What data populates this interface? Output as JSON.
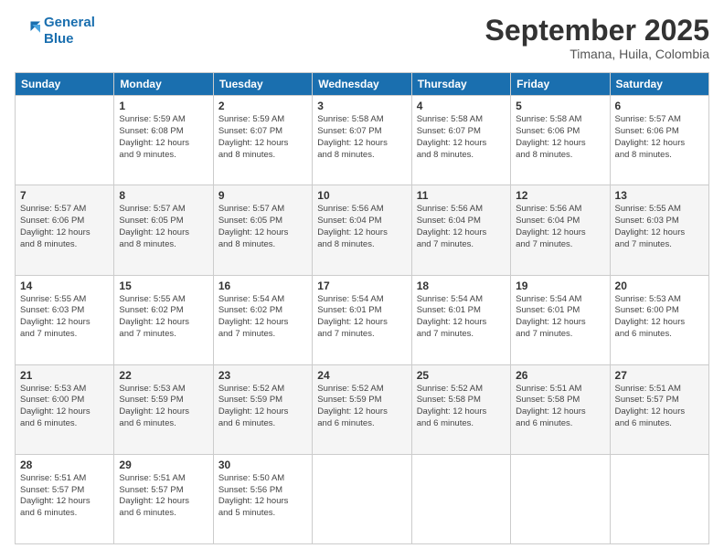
{
  "logo": {
    "line1": "General",
    "line2": "Blue"
  },
  "title": "September 2025",
  "subtitle": "Timana, Huila, Colombia",
  "days_of_week": [
    "Sunday",
    "Monday",
    "Tuesday",
    "Wednesday",
    "Thursday",
    "Friday",
    "Saturday"
  ],
  "weeks": [
    [
      {
        "day": "",
        "info": ""
      },
      {
        "day": "1",
        "info": "Sunrise: 5:59 AM\nSunset: 6:08 PM\nDaylight: 12 hours\nand 9 minutes."
      },
      {
        "day": "2",
        "info": "Sunrise: 5:59 AM\nSunset: 6:07 PM\nDaylight: 12 hours\nand 8 minutes."
      },
      {
        "day": "3",
        "info": "Sunrise: 5:58 AM\nSunset: 6:07 PM\nDaylight: 12 hours\nand 8 minutes."
      },
      {
        "day": "4",
        "info": "Sunrise: 5:58 AM\nSunset: 6:07 PM\nDaylight: 12 hours\nand 8 minutes."
      },
      {
        "day": "5",
        "info": "Sunrise: 5:58 AM\nSunset: 6:06 PM\nDaylight: 12 hours\nand 8 minutes."
      },
      {
        "day": "6",
        "info": "Sunrise: 5:57 AM\nSunset: 6:06 PM\nDaylight: 12 hours\nand 8 minutes."
      }
    ],
    [
      {
        "day": "7",
        "info": "Sunrise: 5:57 AM\nSunset: 6:06 PM\nDaylight: 12 hours\nand 8 minutes."
      },
      {
        "day": "8",
        "info": "Sunrise: 5:57 AM\nSunset: 6:05 PM\nDaylight: 12 hours\nand 8 minutes."
      },
      {
        "day": "9",
        "info": "Sunrise: 5:57 AM\nSunset: 6:05 PM\nDaylight: 12 hours\nand 8 minutes."
      },
      {
        "day": "10",
        "info": "Sunrise: 5:56 AM\nSunset: 6:04 PM\nDaylight: 12 hours\nand 8 minutes."
      },
      {
        "day": "11",
        "info": "Sunrise: 5:56 AM\nSunset: 6:04 PM\nDaylight: 12 hours\nand 7 minutes."
      },
      {
        "day": "12",
        "info": "Sunrise: 5:56 AM\nSunset: 6:04 PM\nDaylight: 12 hours\nand 7 minutes."
      },
      {
        "day": "13",
        "info": "Sunrise: 5:55 AM\nSunset: 6:03 PM\nDaylight: 12 hours\nand 7 minutes."
      }
    ],
    [
      {
        "day": "14",
        "info": "Sunrise: 5:55 AM\nSunset: 6:03 PM\nDaylight: 12 hours\nand 7 minutes."
      },
      {
        "day": "15",
        "info": "Sunrise: 5:55 AM\nSunset: 6:02 PM\nDaylight: 12 hours\nand 7 minutes."
      },
      {
        "day": "16",
        "info": "Sunrise: 5:54 AM\nSunset: 6:02 PM\nDaylight: 12 hours\nand 7 minutes."
      },
      {
        "day": "17",
        "info": "Sunrise: 5:54 AM\nSunset: 6:01 PM\nDaylight: 12 hours\nand 7 minutes."
      },
      {
        "day": "18",
        "info": "Sunrise: 5:54 AM\nSunset: 6:01 PM\nDaylight: 12 hours\nand 7 minutes."
      },
      {
        "day": "19",
        "info": "Sunrise: 5:54 AM\nSunset: 6:01 PM\nDaylight: 12 hours\nand 7 minutes."
      },
      {
        "day": "20",
        "info": "Sunrise: 5:53 AM\nSunset: 6:00 PM\nDaylight: 12 hours\nand 6 minutes."
      }
    ],
    [
      {
        "day": "21",
        "info": "Sunrise: 5:53 AM\nSunset: 6:00 PM\nDaylight: 12 hours\nand 6 minutes."
      },
      {
        "day": "22",
        "info": "Sunrise: 5:53 AM\nSunset: 5:59 PM\nDaylight: 12 hours\nand 6 minutes."
      },
      {
        "day": "23",
        "info": "Sunrise: 5:52 AM\nSunset: 5:59 PM\nDaylight: 12 hours\nand 6 minutes."
      },
      {
        "day": "24",
        "info": "Sunrise: 5:52 AM\nSunset: 5:59 PM\nDaylight: 12 hours\nand 6 minutes."
      },
      {
        "day": "25",
        "info": "Sunrise: 5:52 AM\nSunset: 5:58 PM\nDaylight: 12 hours\nand 6 minutes."
      },
      {
        "day": "26",
        "info": "Sunrise: 5:51 AM\nSunset: 5:58 PM\nDaylight: 12 hours\nand 6 minutes."
      },
      {
        "day": "27",
        "info": "Sunrise: 5:51 AM\nSunset: 5:57 PM\nDaylight: 12 hours\nand 6 minutes."
      }
    ],
    [
      {
        "day": "28",
        "info": "Sunrise: 5:51 AM\nSunset: 5:57 PM\nDaylight: 12 hours\nand 6 minutes."
      },
      {
        "day": "29",
        "info": "Sunrise: 5:51 AM\nSunset: 5:57 PM\nDaylight: 12 hours\nand 6 minutes."
      },
      {
        "day": "30",
        "info": "Sunrise: 5:50 AM\nSunset: 5:56 PM\nDaylight: 12 hours\nand 5 minutes."
      },
      {
        "day": "",
        "info": ""
      },
      {
        "day": "",
        "info": ""
      },
      {
        "day": "",
        "info": ""
      },
      {
        "day": "",
        "info": ""
      }
    ]
  ]
}
